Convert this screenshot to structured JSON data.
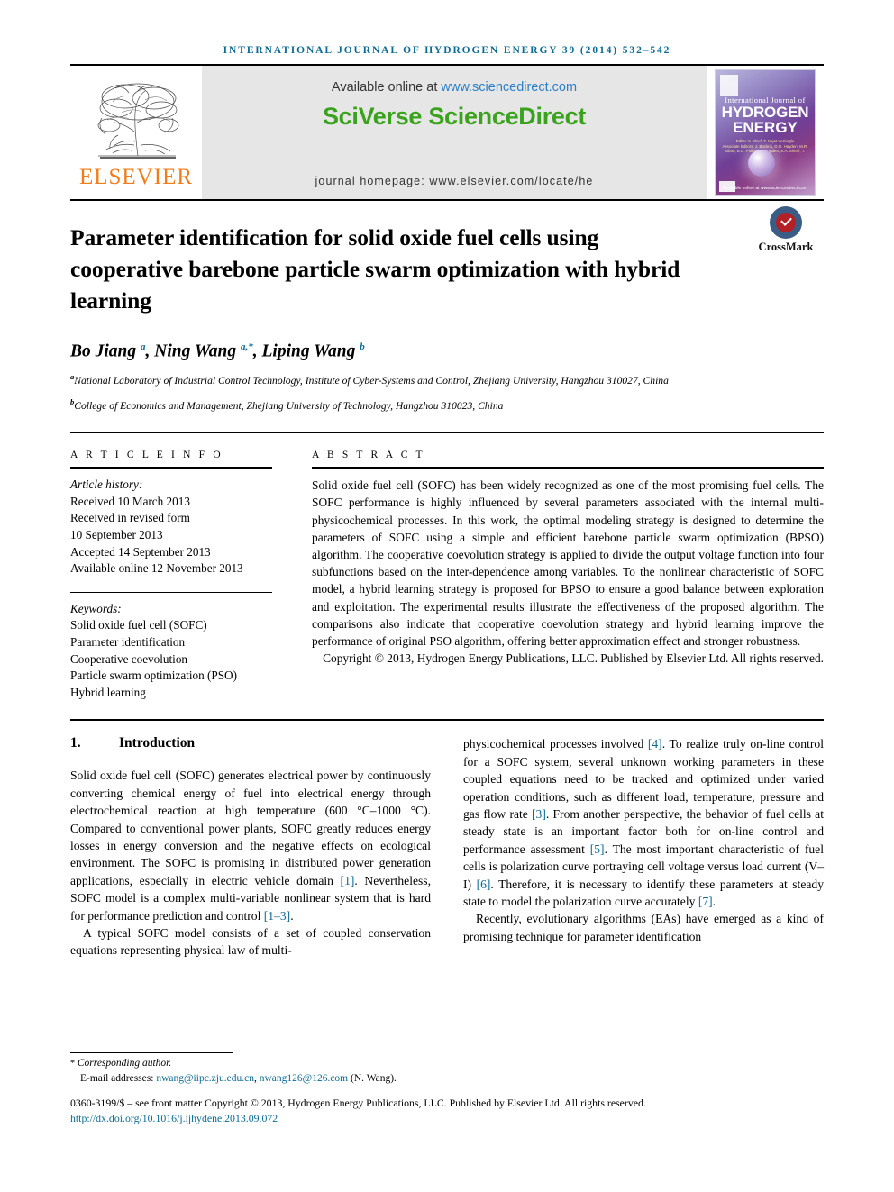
{
  "running_head": "International Journal of Hydrogen Energy 39 (2014) 532–542",
  "masthead": {
    "available_prefix": "Available online at ",
    "sciencedirect_url": "www.sciencedirect.com",
    "brand": "SciVerse ScienceDirect",
    "homepage": "journal homepage: www.elsevier.com/locate/he",
    "publisher_name": "ELSEVIER",
    "cover": {
      "line1": "International Journal of",
      "line2": "HYDROGEN",
      "line3": "ENERGY",
      "editors": "Editor-in-Chief: T. Nejat Veziroglu\nAssociate Editors: J. Bockris, D.O. Hayden, M.R. Islam, B.G. Pollet, J.M. Ogden, S.A. Sherif, T. Norby",
      "bottom": "Available online at www.sciencedirect.com"
    }
  },
  "article": {
    "title": "Parameter identification for solid oxide fuel cells using cooperative barebone particle swarm optimization with hybrid learning",
    "crossmark_label": "CrossMark",
    "authors_html": "Bo Jiang <sup>a</sup>, Ning Wang <sup>a,</sup><sup>*</sup>, Liping Wang <sup>b</sup>",
    "affiliation_a": "National Laboratory of Industrial Control Technology, Institute of Cyber-Systems and Control, Zhejiang University, Hangzhou 310027, China",
    "affiliation_b": "College of Economics and Management, Zhejiang University of Technology, Hangzhou 310023, China",
    "affil_marker_a": "a",
    "affil_marker_b": "b"
  },
  "article_info": {
    "heading": "A R T I C L E   I N F O",
    "history_title": "Article history:",
    "history": [
      "Received 10 March 2013",
      "Received in revised form",
      "10 September 2013",
      "Accepted 14 September 2013",
      "Available online 12 November 2013"
    ],
    "keywords_title": "Keywords:",
    "keywords": [
      "Solid oxide fuel cell (SOFC)",
      "Parameter identification",
      "Cooperative coevolution",
      "Particle swarm optimization (PSO)",
      "Hybrid learning"
    ]
  },
  "abstract": {
    "heading": "A B S T R A C T",
    "body": "Solid oxide fuel cell (SOFC) has been widely recognized as one of the most promising fuel cells. The SOFC performance is highly influenced by several parameters associated with the internal multi-physicochemical processes. In this work, the optimal modeling strategy is designed to determine the parameters of SOFC using a simple and efficient barebone particle swarm optimization (BPSO) algorithm. The cooperative coevolution strategy is applied to divide the output voltage function into four subfunctions based on the inter-dependence among variables. To the nonlinear characteristic of SOFC model, a hybrid learning strategy is proposed for BPSO to ensure a good balance between exploration and exploitation. The experimental results illustrate the effectiveness of the proposed algorithm. The comparisons also indicate that cooperative coevolution strategy and hybrid learning improve the performance of original PSO algorithm, offering better approximation effect and stronger robustness.",
    "copyright": "Copyright © 2013, Hydrogen Energy Publications, LLC. Published by Elsevier Ltd. All rights reserved."
  },
  "introduction": {
    "number": "1.",
    "heading": "Introduction",
    "left_p1_a": "Solid oxide fuel cell (SOFC) generates electrical power by continuously converting chemical energy of fuel into electrical energy through electrochemical reaction at high temperature (600 °C–1000 °C). Compared to conventional power plants, SOFC greatly reduces energy losses in energy conversion and the negative effects on ecological environment. The SOFC is promising in distributed power generation applications, especially in electric vehicle domain ",
    "left_p1_ref1": "[1]",
    "left_p1_b": ". Nevertheless, SOFC model is a complex multi-variable nonlinear system that is hard for performance prediction and control ",
    "left_p1_ref2": "[1–3]",
    "left_p1_c": ".",
    "left_p2": "A typical SOFC model consists of a set of coupled conservation equations representing physical law of multi-",
    "right_p1_a": "physicochemical processes involved ",
    "right_p1_ref4": "[4]",
    "right_p1_b": ". To realize truly on-line control for a SOFC system, several unknown working parameters in these coupled equations need to be tracked and optimized under varied operation conditions, such as different load, temperature, pressure and gas flow rate ",
    "right_p1_ref3": "[3]",
    "right_p1_c": ". From another perspective, the behavior of fuel cells at steady state is an important factor both for on-line control and performance assessment ",
    "right_p1_ref5": "[5]",
    "right_p1_d": ". The most important characteristic of fuel cells is polarization curve portraying cell voltage versus load current (V–I) ",
    "right_p1_ref6": "[6]",
    "right_p1_e": ". Therefore, it is necessary to identify these parameters at steady state to model the polarization curve accurately ",
    "right_p1_ref7": "[7]",
    "right_p1_f": ".",
    "right_p2": "Recently, evolutionary algorithms (EAs) have emerged as a kind of promising technique for parameter identification"
  },
  "footnote": {
    "corresponding": "Corresponding author.",
    "email_label": "E-mail addresses:",
    "email1": "nwang@iipc.zju.edu.cn",
    "email_sep": ", ",
    "email2": "nwang126@126.com",
    "email_suffix": " (N. Wang)."
  },
  "footer": {
    "issn_line": "0360-3199/$ – see front matter Copyright © 2013, Hydrogen Energy Publications, LLC. Published by Elsevier Ltd. All rights reserved.",
    "doi": "http://dx.doi.org/10.1016/j.ijhydene.2013.09.072"
  },
  "colors": {
    "accent_blue": "#0b6a93",
    "link_blue": "#2a7fc9",
    "sciencedirect_green": "#3aa21c",
    "elsevier_orange": "#f07d19"
  }
}
